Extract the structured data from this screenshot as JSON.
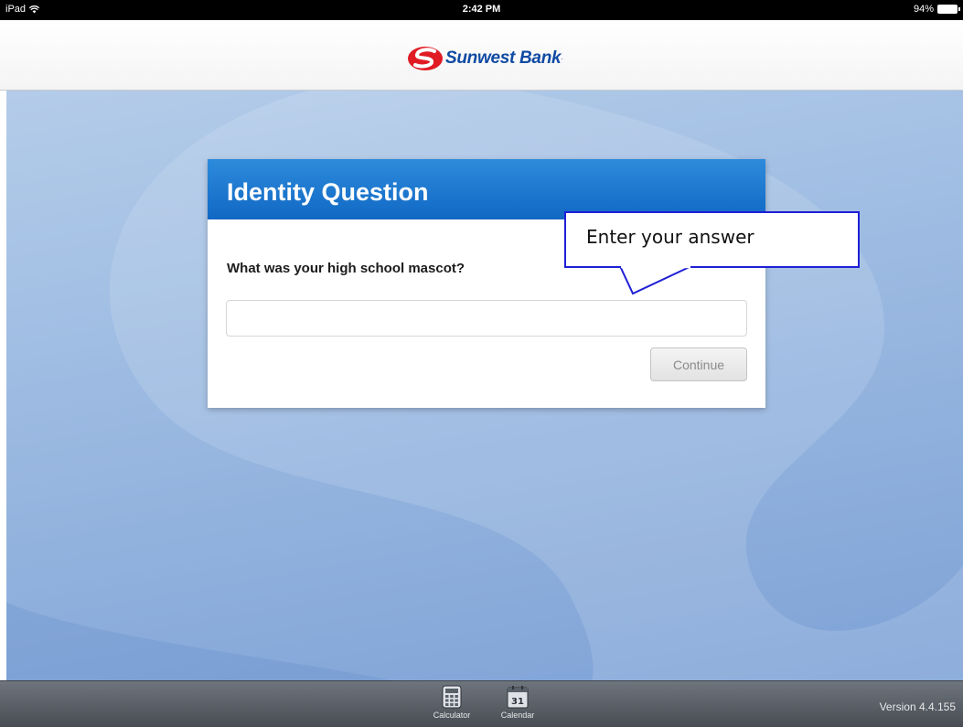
{
  "status_bar": {
    "device": "iPad",
    "time": "2:42 PM",
    "battery": "94%",
    "icons": [
      "wifi-icon",
      "battery-icon"
    ]
  },
  "header": {
    "brand": "Sunwest Bank",
    "brand_color": "#0f4aa3",
    "logo_color": "#e01b24"
  },
  "card": {
    "title": "Identity Question",
    "question": "What was your high school mascot?",
    "answer_value": "",
    "answer_placeholder": "",
    "continue_label": "Continue",
    "header_color": "#1a74cf"
  },
  "callout": {
    "text": "Enter your answer",
    "border_color": "#1f1fd6"
  },
  "toolbar": {
    "items": [
      {
        "label": "Calculator",
        "icon": "calculator-icon"
      },
      {
        "label": "Calendar",
        "icon": "calendar-icon",
        "day": "31"
      }
    ],
    "version": "Version 4.4.155"
  }
}
